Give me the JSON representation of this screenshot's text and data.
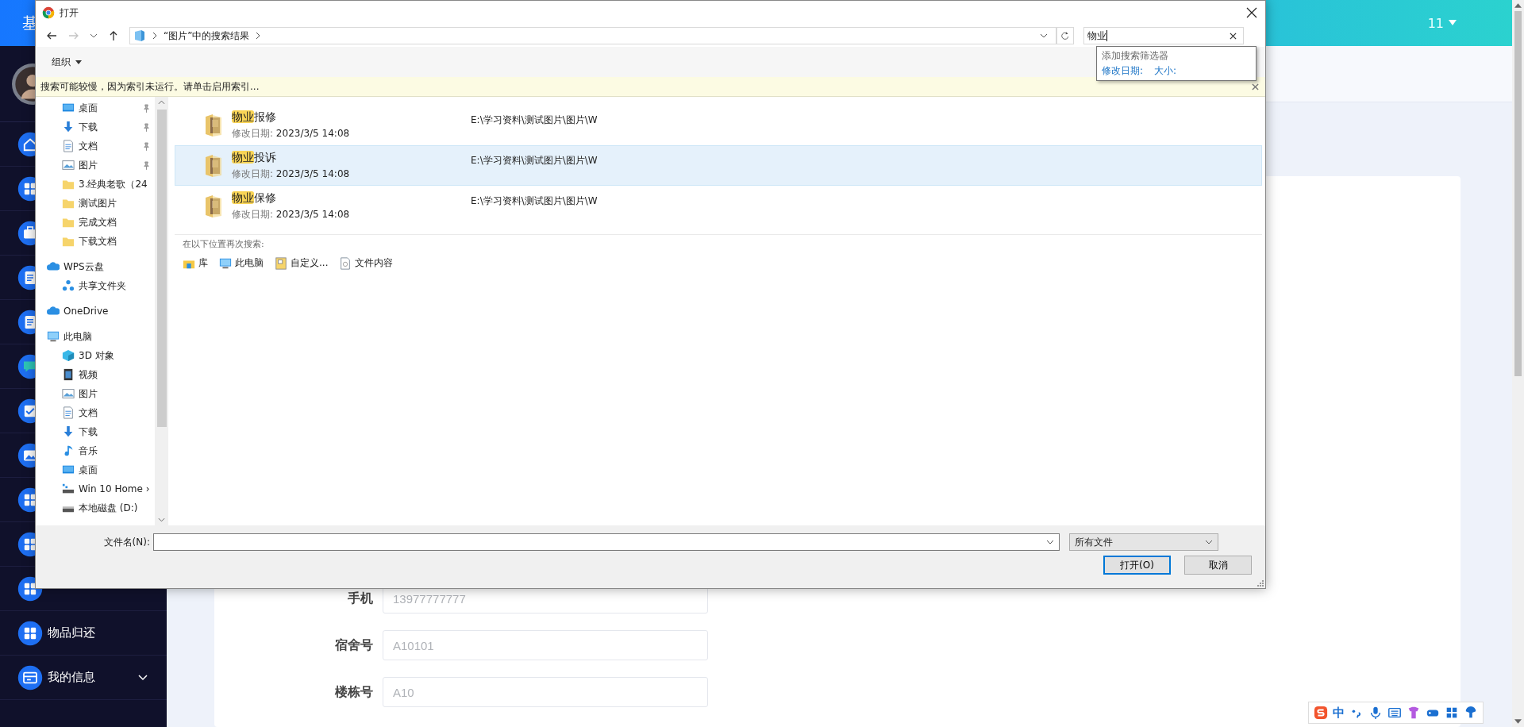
{
  "app": {
    "title": "基",
    "user": "11"
  },
  "sidebar": {
    "items": [
      {
        "kind": "home"
      },
      {
        "kind": "grid"
      },
      {
        "kind": "case"
      },
      {
        "kind": "doc"
      },
      {
        "kind": "doc"
      },
      {
        "kind": "chat"
      },
      {
        "kind": "check"
      },
      {
        "kind": "image"
      },
      {
        "kind": "grid"
      },
      {
        "kind": "grid"
      },
      {
        "kind": "grid"
      },
      {
        "kind": "grid",
        "label": "物品归还"
      },
      {
        "kind": "card",
        "label": "我的信息",
        "expanded": false
      }
    ]
  },
  "form": {
    "fields": [
      {
        "label": "手机",
        "placeholder": "13977777777"
      },
      {
        "label": "宿舍号",
        "placeholder": "A10101"
      },
      {
        "label": "楼栋号",
        "placeholder": "A10"
      }
    ]
  },
  "dialog": {
    "title": "打开",
    "navigation": {
      "forward_disabled": true
    },
    "address": "“图片”中的搜索结果",
    "search": {
      "value": "物业",
      "suggestions": {
        "heading": "添加搜索筛选器",
        "filters": [
          "修改日期:",
          "大小:"
        ]
      }
    },
    "toolbar": {
      "organize": "组织"
    },
    "info_bar": "搜索可能较慢，因为索引未运行。请单击启用索引...",
    "nav_pane": {
      "quick_access": [
        {
          "label": "桌面",
          "kind": "desktop",
          "pinned": true
        },
        {
          "label": "下载",
          "kind": "download",
          "pinned": true
        },
        {
          "label": "文档",
          "kind": "doc",
          "pinned": true
        },
        {
          "label": "图片",
          "kind": "picture",
          "pinned": true
        },
        {
          "label": "3.经典老歌（24",
          "kind": "folder",
          "pinned": false
        },
        {
          "label": "测试图片",
          "kind": "folder",
          "pinned": false
        },
        {
          "label": "完成文档",
          "kind": "folder",
          "pinned": false
        },
        {
          "label": "下载文档",
          "kind": "folder",
          "pinned": false
        }
      ],
      "items": [
        {
          "label": "WPS云盘",
          "kind": "cloud",
          "children": [
            {
              "label": "共享文件夹",
              "kind": "share"
            }
          ]
        },
        {
          "label": "OneDrive",
          "kind": "cloud"
        },
        {
          "label": "此电脑",
          "kind": "pc",
          "children": [
            {
              "label": "3D 对象",
              "kind": "cube"
            },
            {
              "label": "视频",
              "kind": "video"
            },
            {
              "label": "图片",
              "kind": "picture"
            },
            {
              "label": "文档",
              "kind": "doc"
            },
            {
              "label": "下载",
              "kind": "download"
            },
            {
              "label": "音乐",
              "kind": "music"
            },
            {
              "label": "桌面",
              "kind": "desktop"
            },
            {
              "label": "Win 10 Home ›",
              "kind": "netdrive"
            },
            {
              "label": "本地磁盘 (D:)",
              "kind": "drive"
            }
          ]
        }
      ]
    },
    "results": [
      {
        "match": "物业",
        "rest": "报修",
        "date_label": "修改日期:",
        "date": "2023/3/5 14:08",
        "path": "E:\\学习资料\\测试图片\\图片\\W",
        "selected": false
      },
      {
        "match": "物业",
        "rest": "投诉",
        "date_label": "修改日期:",
        "date": "2023/3/5 14:08",
        "path": "E:\\学习资料\\测试图片\\图片\\W",
        "selected": true
      },
      {
        "match": "物业",
        "rest": "保修",
        "date_label": "修改日期:",
        "date": "2023/3/5 14:08",
        "path": "E:\\学习资料\\测试图片\\图片\\W",
        "selected": false
      }
    ],
    "search_again": {
      "heading": "在以下位置再次搜索:",
      "locations": [
        {
          "label": "库",
          "kind": "library"
        },
        {
          "label": "此电脑",
          "kind": "pc"
        },
        {
          "label": "自定义...",
          "kind": "custom"
        },
        {
          "label": "文件内容",
          "kind": "file"
        }
      ]
    },
    "file_name": {
      "label": "文件名(N):"
    },
    "file_type": "所有文件",
    "buttons": [
      {
        "label": "打开(O)",
        "default": true
      },
      {
        "label": "取消",
        "default": false
      }
    ]
  },
  "ime_toolbar": {
    "mode": "中"
  }
}
